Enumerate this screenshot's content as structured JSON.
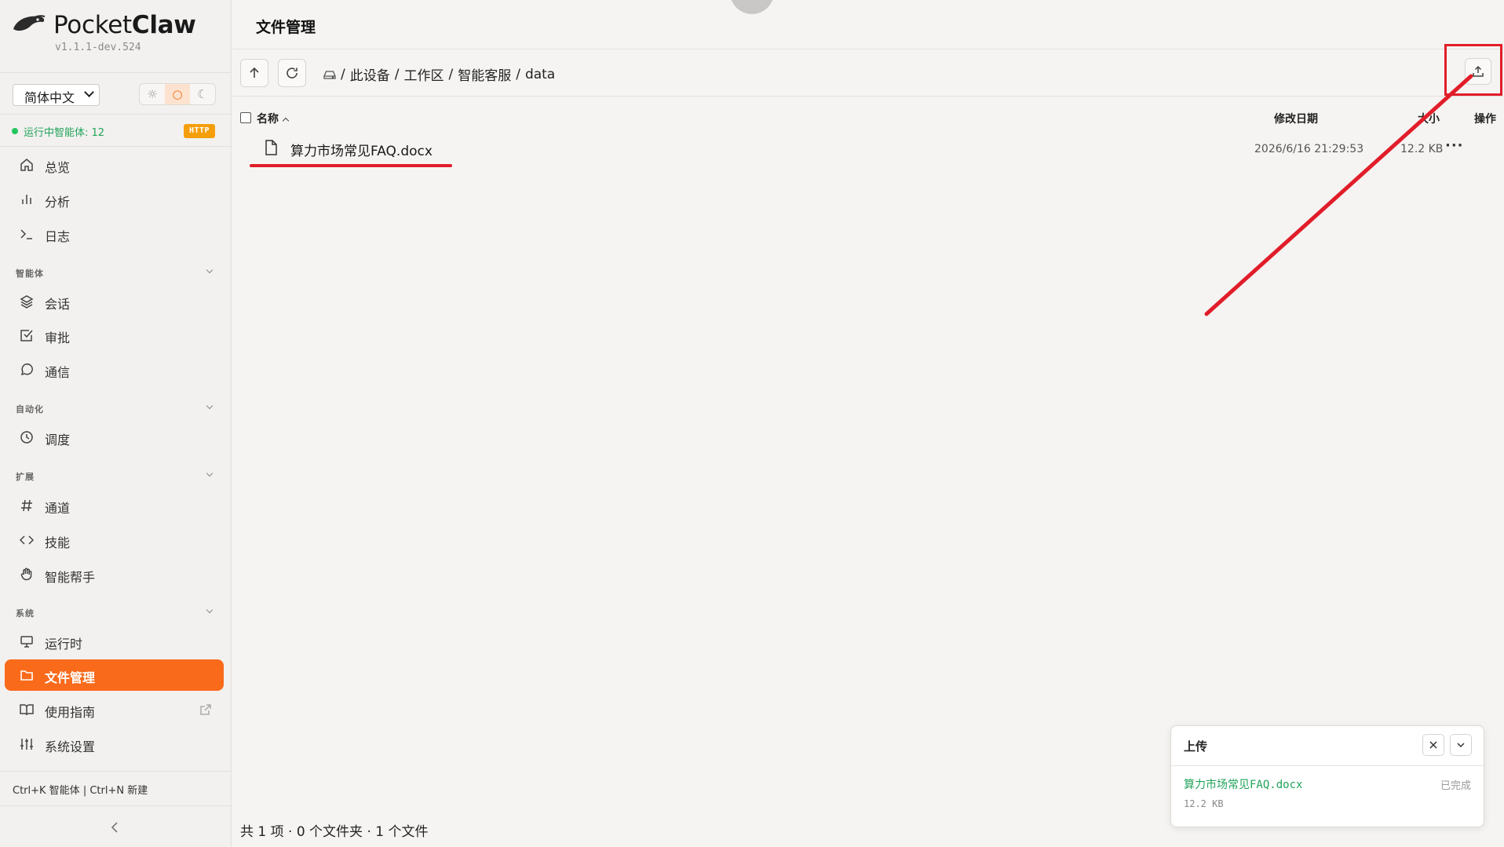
{
  "brand": {
    "name_light": "Pocket",
    "name_bold": "Claw",
    "version": "v1.1.1-dev.524"
  },
  "language": {
    "selected": "简体中文"
  },
  "theme": {
    "options": [
      "☼",
      "○",
      "☾"
    ],
    "active_index": 1
  },
  "status": {
    "running_agents": "运行中智能体: 12",
    "protocol_badge": "HTTP"
  },
  "nav": {
    "overview": "总览",
    "analytics": "分析",
    "logs": "日志",
    "section_agents": "智能体",
    "sessions": "会话",
    "approvals": "审批",
    "messaging": "通信",
    "section_automation": "自动化",
    "scheduling": "调度",
    "section_extensions": "扩展",
    "channels": "通道",
    "skills": "技能",
    "assistant": "智能帮手",
    "section_system": "系统",
    "runtime": "运行时",
    "file_manager": "文件管理",
    "guide": "使用指南",
    "settings": "系统设置"
  },
  "shortcuts": "Ctrl+K 智能体 | Ctrl+N 新建",
  "page": {
    "title": "文件管理"
  },
  "breadcrumb": [
    "此设备",
    "工作区",
    "智能客服",
    "data"
  ],
  "columns": {
    "name": "名称",
    "modified": "修改日期",
    "size": "大小",
    "actions": "操作"
  },
  "files": [
    {
      "name": "算力市场常见FAQ.docx",
      "modified": "2026/6/16 21:29:53",
      "size": "12.2 KB",
      "actions": "···"
    }
  ],
  "footer": {
    "summary": "共 1 项 · 0 个文件夹 · 1 个文件"
  },
  "upload": {
    "title": "上传",
    "file_name": "算力市场常见FAQ.docx",
    "file_size": "12.2 KB",
    "status": "已完成"
  },
  "colors": {
    "accent": "#f96a1b",
    "success": "#22c55e",
    "annotation": "#e11d2a",
    "badge": "#f59e0b"
  }
}
